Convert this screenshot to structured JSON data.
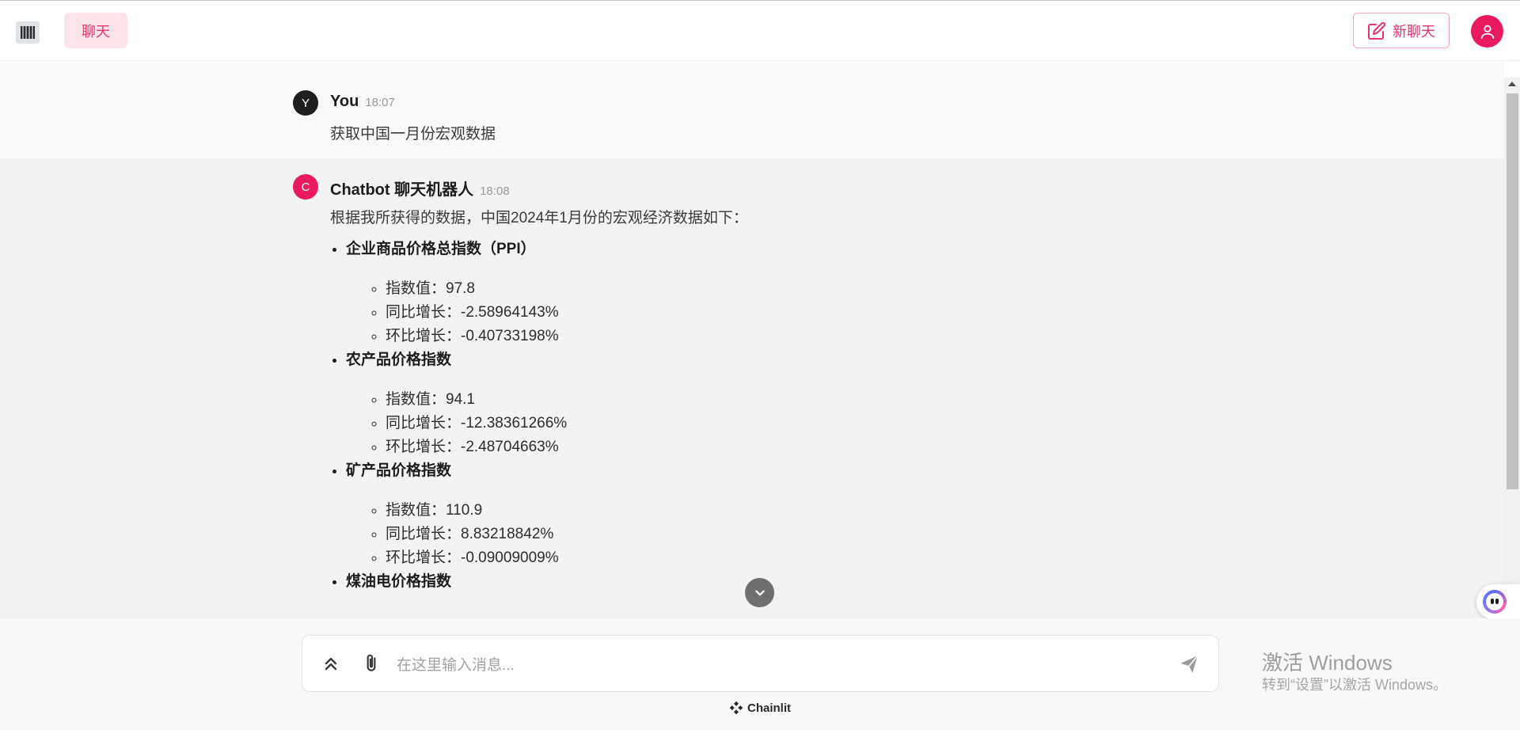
{
  "header": {
    "logo_icon": "app-logo-icon",
    "chat_tab_label": "聊天",
    "new_chat_label": "新聊天",
    "new_chat_icon": "edit-icon",
    "user_icon": "user-icon",
    "accent_color": "#ea1a5e"
  },
  "messages": [
    {
      "avatar_letter": "Y",
      "author": "You",
      "time": "18:07",
      "text": "获取中国一月份宏观数据"
    },
    {
      "avatar_letter": "C",
      "author": "Chatbot 聊天机器人",
      "time": "18:08",
      "intro": "根据我所获得的数据，中国2024年1月份的宏观经济数据如下：",
      "sections": [
        {
          "title": "企业商品价格总指数（PPI）",
          "items": [
            "指数值：97.8",
            "同比增长：-2.58964143%",
            "环比增长：-0.40733198%"
          ]
        },
        {
          "title": "农产品价格指数",
          "items": [
            "指数值：94.1",
            "同比增长：-12.38361266%",
            "环比增长：-2.48704663%"
          ]
        },
        {
          "title": "矿产品价格指数",
          "items": [
            "指数值：110.9",
            "同比增长：8.83218842%",
            "环比增长：-0.09009009%"
          ]
        },
        {
          "title": "煤油电价格指数",
          "items": []
        }
      ]
    }
  ],
  "composer": {
    "placeholder": "在这里输入消息..."
  },
  "footer": {
    "brand": "Chainlit"
  },
  "watermark": {
    "title": "激活 Windows",
    "subtitle": "转到“设置”以激活 Windows。"
  }
}
